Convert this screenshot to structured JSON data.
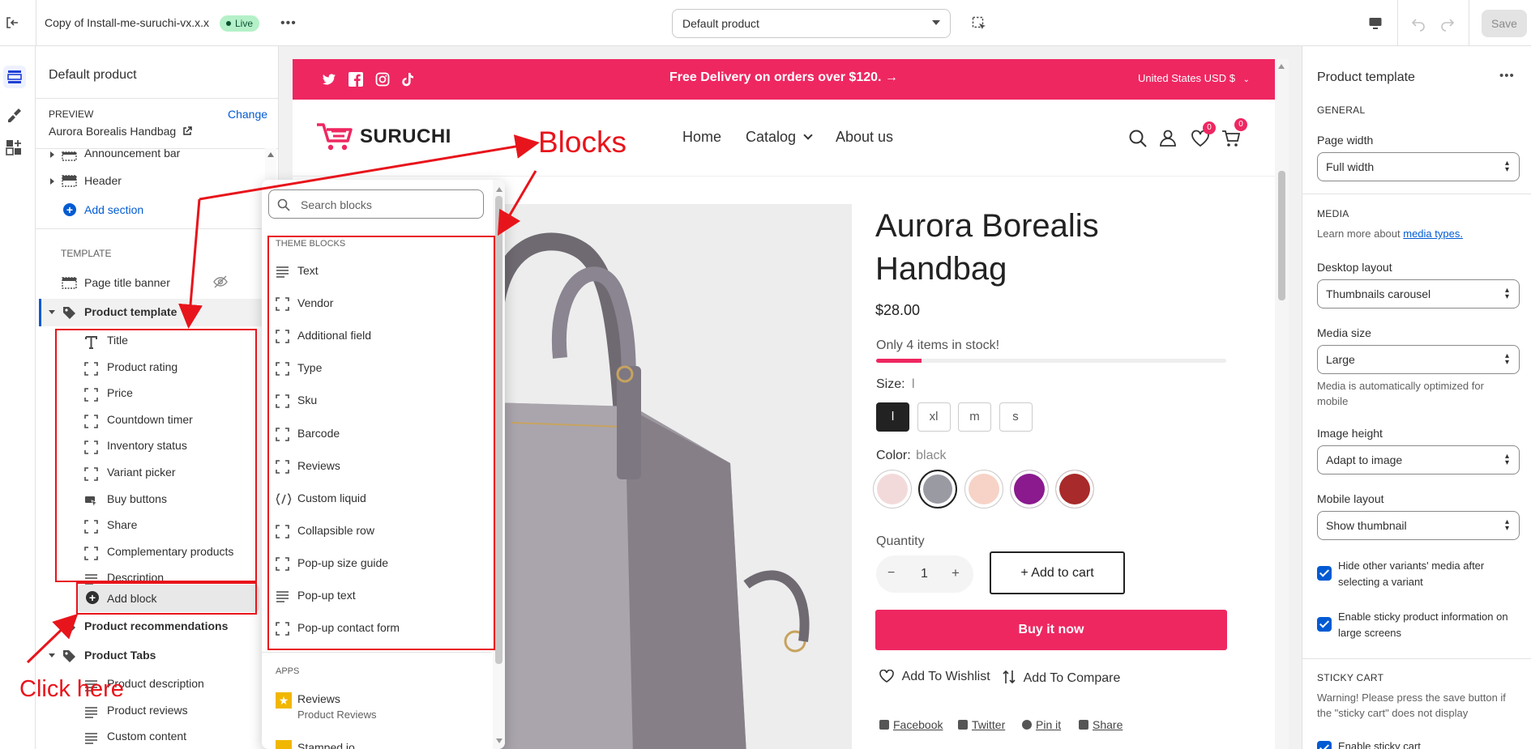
{
  "topbar": {
    "store_name": "Copy of Install-me-suruchi-vx.x.x",
    "live_badge": "Live",
    "template_select": "Default product",
    "save_label": "Save"
  },
  "left": {
    "header_title": "Default product",
    "preview_label": "PREVIEW",
    "change_label": "Change",
    "preview_product": "Aurora Borealis Handbag",
    "sections": {
      "announcement": "Announcement bar",
      "header": "Header",
      "add_section": "Add section"
    },
    "template_heading": "TEMPLATE",
    "page_title_banner": "Page title banner",
    "product_template": "Product template",
    "blocks": [
      "Title",
      "Product rating",
      "Price",
      "Countdown timer",
      "Inventory status",
      "Variant picker",
      "Buy buttons",
      "Share",
      "Complementary products",
      "Description"
    ],
    "add_block": "Add block",
    "product_recommendations": "Product recommendations",
    "product_tabs": "Product Tabs",
    "tab_blocks": [
      "Product description",
      "Product reviews",
      "Custom content"
    ]
  },
  "popover": {
    "search_placeholder": "Search blocks",
    "theme_heading": "THEME BLOCKS",
    "theme_blocks": [
      "Text",
      "Vendor",
      "Additional field",
      "Type",
      "Sku",
      "Barcode",
      "Reviews",
      "Custom liquid",
      "Collapsible row",
      "Pop-up size guide",
      "Pop-up text",
      "Pop-up contact form"
    ],
    "apps_heading": "APPS",
    "app_name": "Reviews",
    "app_sub": "Product Reviews",
    "partial_item": "Stamped.io"
  },
  "annotations": {
    "blocks": "Blocks",
    "click_here": "Click here",
    "color": "#e8141b"
  },
  "store": {
    "promo": "Free Delivery on orders over $120. →",
    "currency": "United States USD $",
    "logo": "SURUCHI",
    "nav": [
      "Home",
      "Catalog",
      "About us"
    ],
    "wishlist_count": "0",
    "cart_count": "0",
    "product_title_line1": "Aurora Borealis",
    "product_title_line2": "Handbag",
    "price": "$28.00",
    "stock_text": "Only 4 items in stock!",
    "stock_fraction": 0.13,
    "size_label": "Size:",
    "size_value": "l",
    "sizes": [
      "l",
      "xl",
      "m",
      "s"
    ],
    "color_label": "Color:",
    "color_value": "black",
    "swatch_colors": [
      "#f3dada",
      "#9a9aa2",
      "#f6d3c6",
      "#8a1a8e",
      "#a82a2a"
    ],
    "quantity_label": "Quantity",
    "quantity_value": "1",
    "minus": "−",
    "plus": "+",
    "add_to_cart": "+ Add to cart",
    "buy_now": "Buy it now",
    "wishlist": "Add To Wishlist",
    "compare": "Add To Compare",
    "share_links": [
      "Facebook",
      "Twitter",
      "Pin it",
      "Share"
    ],
    "brand_color": "#ee2761"
  },
  "right": {
    "title": "Product template",
    "general": "GENERAL",
    "page_width_label": "Page width",
    "page_width_value": "Full width",
    "media_heading": "MEDIA",
    "learn_more_prefix": "Learn more about",
    "learn_more_link": "media types.",
    "desktop_layout_label": "Desktop layout",
    "desktop_layout_value": "Thumbnails carousel",
    "media_size_label": "Media size",
    "media_size_value": "Large",
    "media_size_help": "Media is automatically optimized for mobile",
    "image_height_label": "Image height",
    "image_height_value": "Adapt to image",
    "mobile_layout_label": "Mobile layout",
    "mobile_layout_value": "Show thumbnail",
    "hide_variants": "Hide other variants' media after selecting a variant",
    "sticky_info": "Enable sticky product information on large screens",
    "sticky_cart_heading": "STICKY CART",
    "sticky_cart_warning": "Warning! Please press the save button if the \"sticky cart\" does not display",
    "enable_sticky_cart": "Enable sticky cart"
  }
}
